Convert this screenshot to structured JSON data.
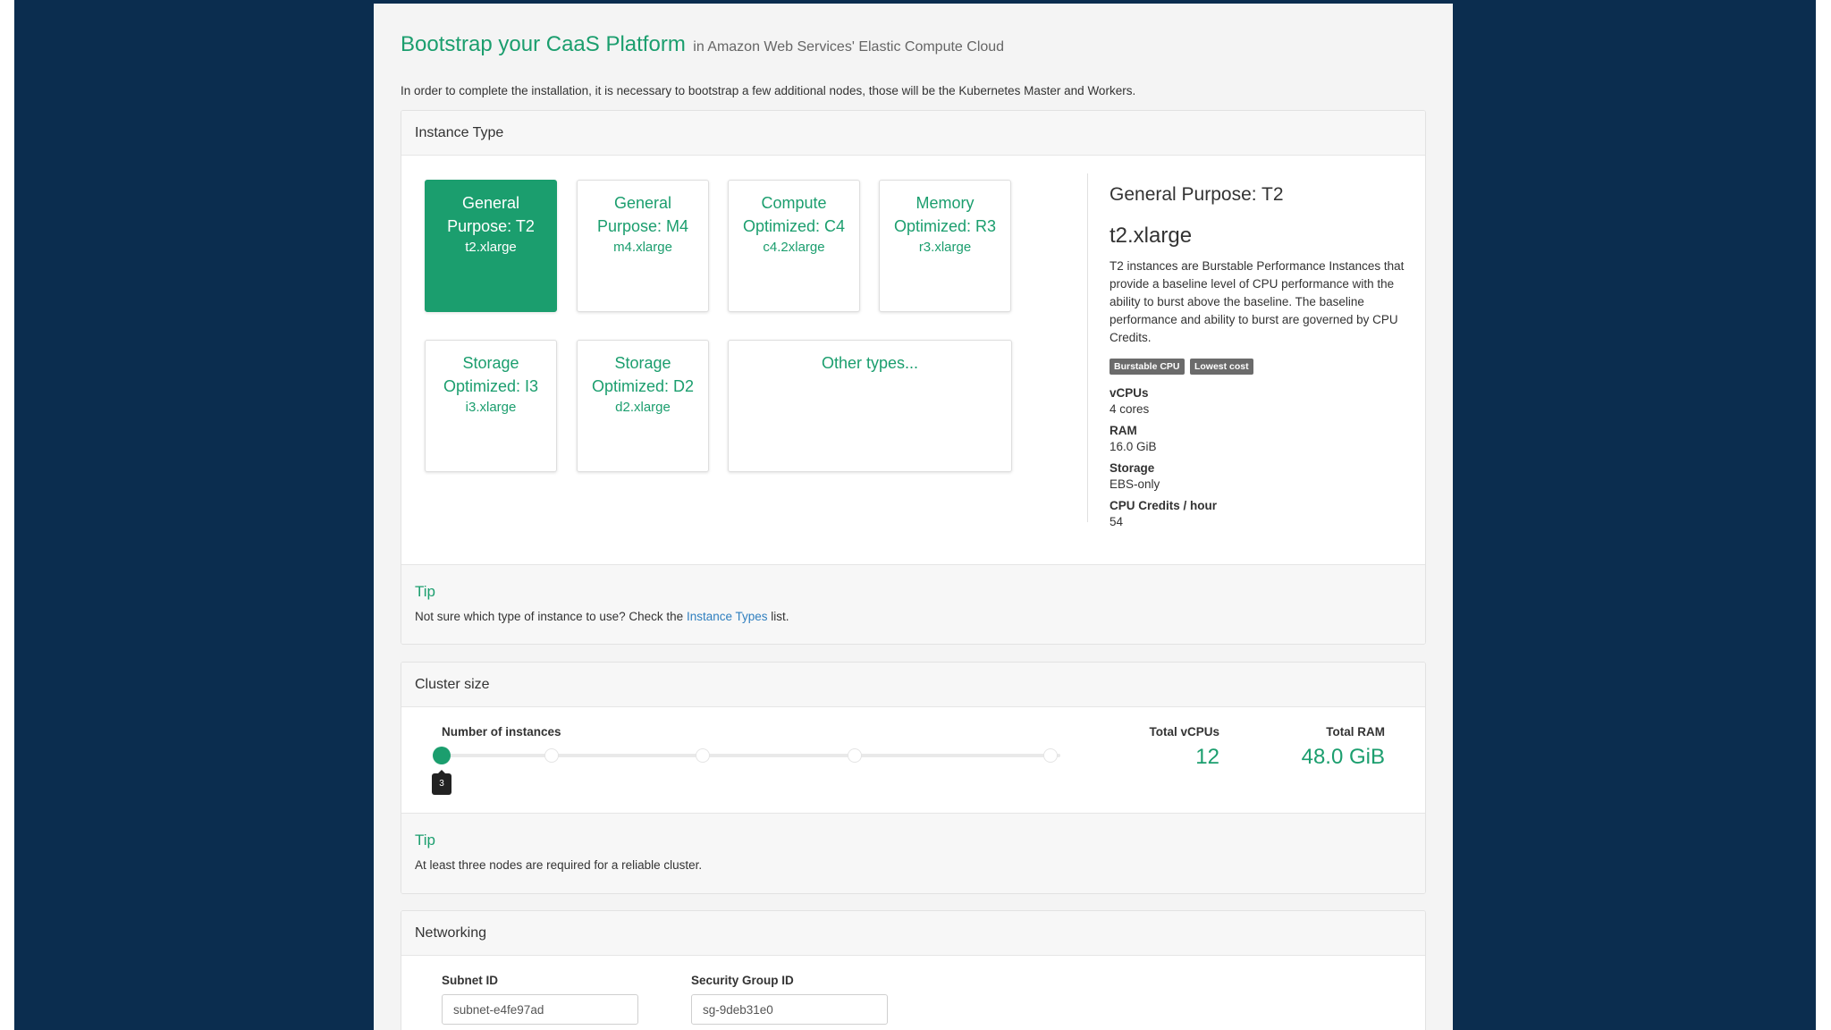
{
  "header": {
    "title": "Bootstrap your CaaS Platform",
    "subtitle": "in Amazon Web Services' Elastic Compute Cloud",
    "intro": "In order to complete the installation, it is necessary to bootstrap a few additional nodes, those will be the Kubernetes Master and Workers."
  },
  "instance_type": {
    "heading": "Instance Type",
    "cards": [
      {
        "name": "General Purpose: T2",
        "size": "t2.xlarge",
        "selected": true
      },
      {
        "name": "General Purpose: M4",
        "size": "m4.xlarge",
        "selected": false
      },
      {
        "name": "Compute Optimized: C4",
        "size": "c4.2xlarge",
        "selected": false
      },
      {
        "name": "Memory Optimized: R3",
        "size": "r3.xlarge",
        "selected": false
      },
      {
        "name": "Storage Optimized: I3",
        "size": "i3.xlarge",
        "selected": false
      },
      {
        "name": "Storage Optimized: D2",
        "size": "d2.xlarge",
        "selected": false
      },
      {
        "name": "Other types...",
        "size": "",
        "selected": false
      }
    ],
    "detail": {
      "title": "General Purpose: T2",
      "size": "t2.xlarge",
      "description": "T2 instances are Burstable Performance Instances that provide a baseline level of CPU performance with the ability to burst above the baseline. The baseline performance and ability to burst are governed by CPU Credits.",
      "badges": [
        "Burstable CPU",
        "Lowest cost"
      ],
      "specs": [
        {
          "label": "vCPUs",
          "value": "4 cores"
        },
        {
          "label": "RAM",
          "value": "16.0 GiB"
        },
        {
          "label": "Storage",
          "value": "EBS-only"
        },
        {
          "label": "CPU Credits / hour",
          "value": "54"
        }
      ]
    },
    "tip": {
      "title": "Tip",
      "text_before": "Not sure which type of instance to use? Check the",
      "link": "Instance Types",
      "text_after": "list."
    }
  },
  "cluster": {
    "heading": "Cluster size",
    "instances_label": "Number of instances",
    "instances_value": "3",
    "total_vcpus_label": "Total vCPUs",
    "total_vcpus": "12",
    "total_ram_label": "Total RAM",
    "total_ram": "48.0 GiB",
    "tip": {
      "title": "Tip",
      "text": "At least three nodes are required for a reliable cluster."
    }
  },
  "networking": {
    "heading": "Networking",
    "subnet_label": "Subnet ID",
    "subnet_value": "subnet-e4fe97ad",
    "security_group_label": "Security Group ID",
    "security_group_value": "sg-9deb31e0"
  },
  "colors": {
    "accent": "#1b9e6e",
    "backdrop": "#0b2d4f",
    "link": "#2f7fbf"
  }
}
